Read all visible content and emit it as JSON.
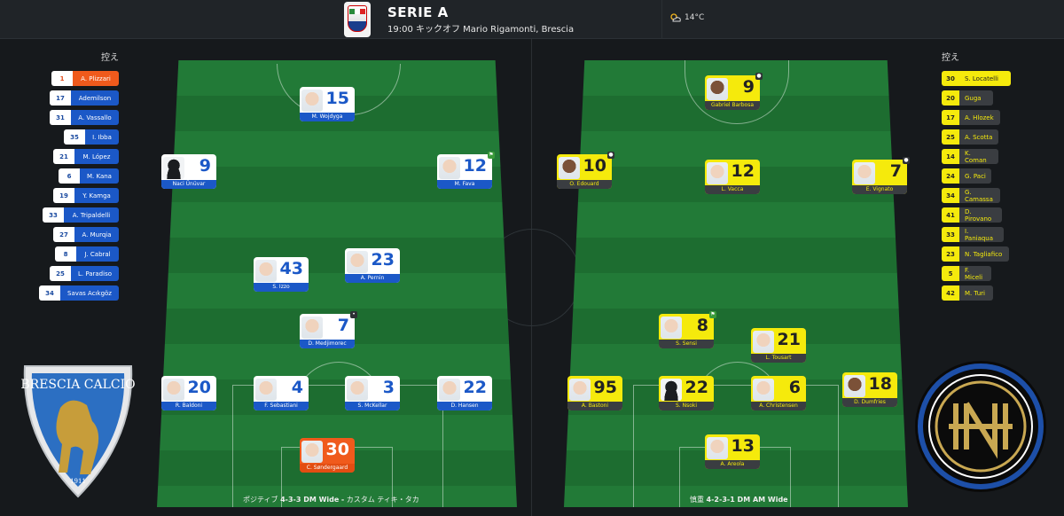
{
  "header": {
    "league": "SERIE A",
    "league_logo_text": "SERIE A TIM",
    "match_info": "19:00 キックオフ Mario Rigamonti, Brescia",
    "temperature": "14°C",
    "weather_icon": "partly-cloudy-icon"
  },
  "home": {
    "bench_title": "控え",
    "crest_text": "BRESCIA CALCIO",
    "crest_year": "1911",
    "bench": [
      {
        "num": "1",
        "name": "A. Plizzari"
      },
      {
        "num": "17",
        "name": "Ademilson"
      },
      {
        "num": "31",
        "name": "A. Vassallo"
      },
      {
        "num": "35",
        "name": "I. Ibba"
      },
      {
        "num": "21",
        "name": "M. López"
      },
      {
        "num": "6",
        "name": "M. Kana"
      },
      {
        "num": "19",
        "name": "Y. Kamga"
      },
      {
        "num": "33",
        "name": "A. Tripaldelli"
      },
      {
        "num": "27",
        "name": "A. Murqia"
      },
      {
        "num": "8",
        "name": "J. Cabral"
      },
      {
        "num": "25",
        "name": "L. Paradiso"
      },
      {
        "num": "34",
        "name": "Savas Acıkgöz"
      }
    ],
    "players": [
      {
        "num": "15",
        "name": "M. Wojdyga"
      },
      {
        "num": "9",
        "name": "Naci Ünüvar"
      },
      {
        "num": "12",
        "name": "M. Fava"
      },
      {
        "num": "43",
        "name": "S. Izzo"
      },
      {
        "num": "23",
        "name": "A. Pernin"
      },
      {
        "num": "7",
        "name": "D. Medjimorec"
      },
      {
        "num": "20",
        "name": "R. Baldoni"
      },
      {
        "num": "4",
        "name": "F. Sebastiani"
      },
      {
        "num": "3",
        "name": "S. McKellar"
      },
      {
        "num": "22",
        "name": "D. Hansen"
      },
      {
        "num": "30",
        "name": "C. Søndergaard"
      }
    ],
    "formation_prefix": "ポジティブ",
    "formation_name": "4-3-3 DM Wide",
    "formation_suffix": "カスタム ティキ・タカ",
    "separator": "-"
  },
  "away": {
    "bench_title": "控え",
    "bench": [
      {
        "num": "30",
        "name": "S. Locatelli"
      },
      {
        "num": "20",
        "name": "Guga"
      },
      {
        "num": "17",
        "name": "A. Hlozek"
      },
      {
        "num": "25",
        "name": "A. Scotta"
      },
      {
        "num": "14",
        "name": "K. Coman"
      },
      {
        "num": "24",
        "name": "G. Paci"
      },
      {
        "num": "34",
        "name": "G. Camassa"
      },
      {
        "num": "41",
        "name": "D. Pirovano"
      },
      {
        "num": "33",
        "name": "I. Paniaqua"
      },
      {
        "num": "23",
        "name": "N. Tagliafico"
      },
      {
        "num": "5",
        "name": "F. Miceli"
      },
      {
        "num": "42",
        "name": "M. Turi"
      }
    ],
    "players": [
      {
        "num": "9",
        "name": "Gabriel Barbosa"
      },
      {
        "num": "10",
        "name": "O. Edouard"
      },
      {
        "num": "12",
        "name": "L. Vacca"
      },
      {
        "num": "7",
        "name": "E. Vignato"
      },
      {
        "num": "8",
        "name": "S. Sensi"
      },
      {
        "num": "21",
        "name": "L. Tousart"
      },
      {
        "num": "95",
        "name": "A. Bastoni"
      },
      {
        "num": "22",
        "name": "S. Nsoki"
      },
      {
        "num": "6",
        "name": "A. Christensen"
      },
      {
        "num": "18",
        "name": "D. Dumfries"
      },
      {
        "num": "13",
        "name": "A. Areola"
      }
    ],
    "formation_prefix": "慎重",
    "formation_name": "4-2-3-1 DM AM Wide"
  },
  "colors": {
    "home_primary": "#1b58c7",
    "home_gk": "#f05a1c",
    "away_primary": "#f5ea0c",
    "pitch": "#227a37",
    "background": "#16191c"
  }
}
